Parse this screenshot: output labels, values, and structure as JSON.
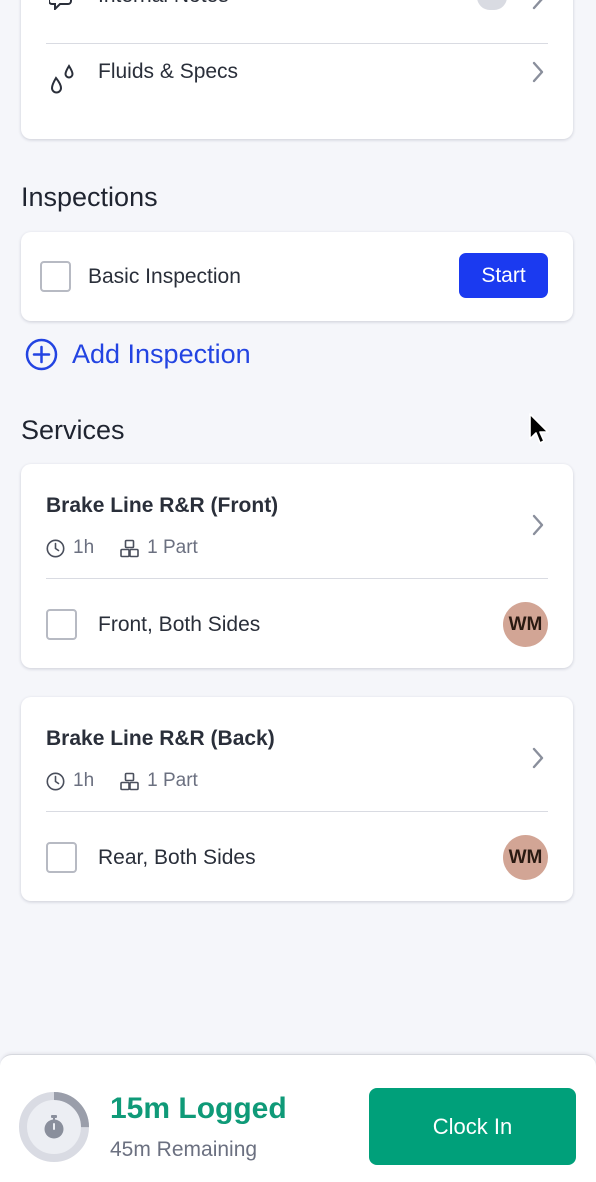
{
  "top_card": {
    "notes_label": "Internal Notes",
    "fluids_label": "Fluids & Specs"
  },
  "inspections": {
    "title": "Inspections",
    "items": [
      {
        "label": "Basic Inspection",
        "action": "Start"
      }
    ],
    "add_label": "Add Inspection"
  },
  "services": {
    "title": "Services",
    "items": [
      {
        "title": "Brake Line R&R (Front)",
        "hours": "1h",
        "parts": "1 Part",
        "task": "Front, Both Sides",
        "assignee": "WM"
      },
      {
        "title": "Brake Line R&R (Back)",
        "hours": "1h",
        "parts": "1 Part",
        "task": "Rear, Both Sides",
        "assignee": "WM"
      }
    ]
  },
  "footer": {
    "logged": "15m Logged",
    "remaining": "45m Remaining",
    "clock_in": "Clock In",
    "logged_fraction": 0.25
  },
  "colors": {
    "primary_blue": "#1b3af0",
    "link_blue": "#2344e2",
    "green": "#00a07a",
    "logged_green": "#0f9a78",
    "avatar_bg": "#d2a595"
  }
}
